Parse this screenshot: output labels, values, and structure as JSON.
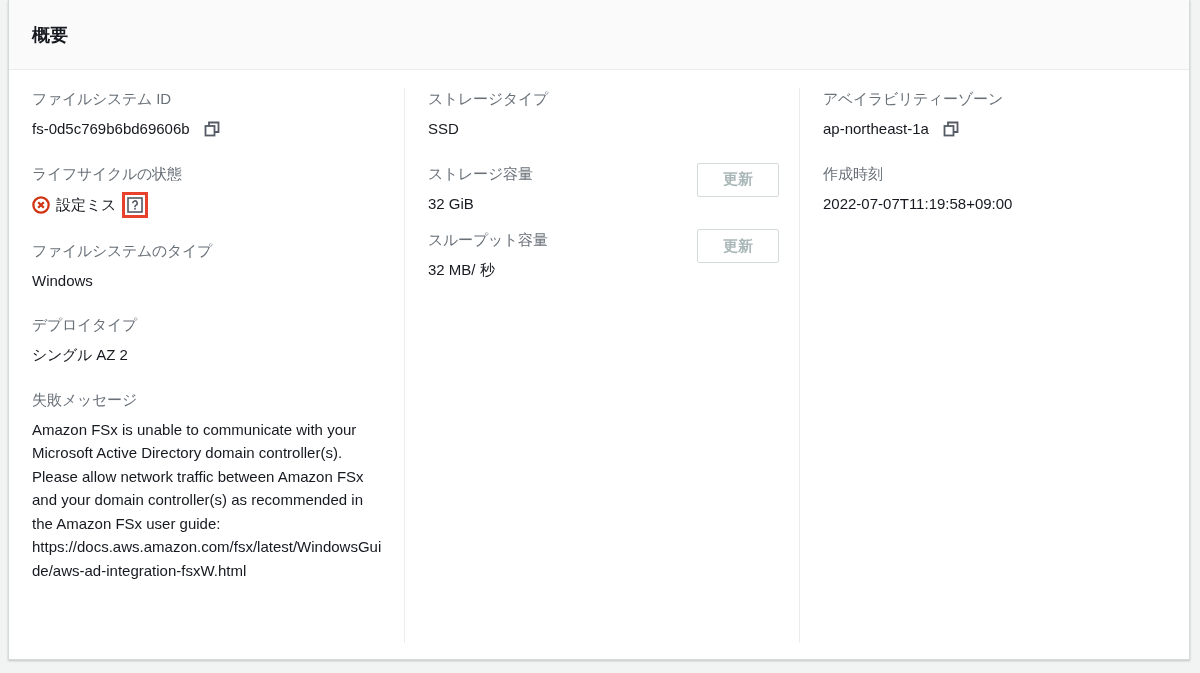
{
  "panel": {
    "title": "概要"
  },
  "columns": [
    {
      "fields": [
        {
          "label": "ファイルシステム ID",
          "value": "fs-0d5c769b6bd69606b",
          "copyable": true
        },
        {
          "label": "ライフサイクルの状態",
          "value": "設定ミス",
          "error": true,
          "help": true,
          "highlighted": true
        },
        {
          "label": "ファイルシステムのタイプ",
          "value": "Windows"
        },
        {
          "label": "デプロイタイプ",
          "value": "シングル AZ 2"
        },
        {
          "label": "失敗メッセージ",
          "value": "Amazon FSx is unable to communicate with your Microsoft Active Directory domain controller(s). Please allow network traffic between Amazon FSx and your domain controller(s) as recommended in the Amazon FSx user guide: https://docs.aws.amazon.com/fsx/latest/WindowsGuide/aws-ad-integration-fsxW.html"
        }
      ]
    },
    {
      "fields": [
        {
          "label": "ストレージタイプ",
          "value": "SSD"
        },
        {
          "label": "ストレージ容量",
          "value": "32 GiB",
          "action": {
            "label": "更新",
            "disabled": true
          }
        },
        {
          "label": "スループット容量",
          "value": "32 MB/ 秒",
          "action": {
            "label": "更新",
            "disabled": true
          }
        }
      ]
    },
    {
      "fields": [
        {
          "label": "アベイラビリティーゾーン",
          "value": "ap-northeast-1a",
          "copyable": true
        },
        {
          "label": "作成時刻",
          "value": "2022-07-07T11:19:58+09:00"
        }
      ]
    }
  ]
}
